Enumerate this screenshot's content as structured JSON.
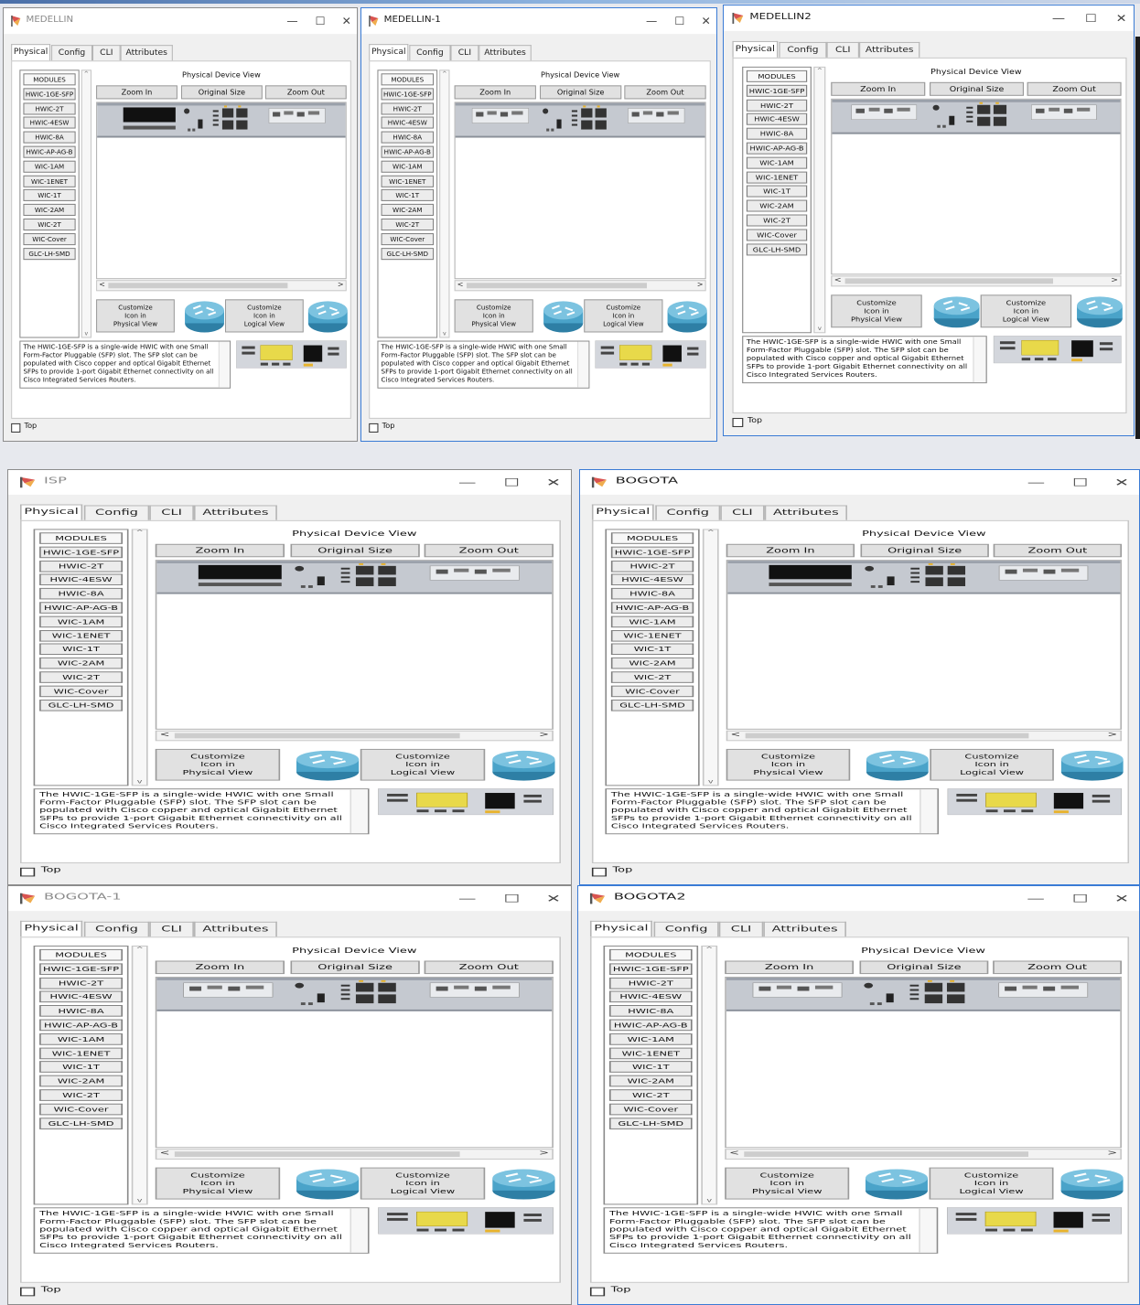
{
  "common": {
    "tabs": [
      "Physical",
      "Config",
      "CLI",
      "Attributes"
    ],
    "physical_device_view_label": "Physical Device View",
    "zoom_in": "Zoom In",
    "original_size": "Original Size",
    "zoom_out": "Zoom Out",
    "module_header": "MODULES",
    "module_list": [
      "HWIC-1GE-SFP",
      "HWIC-2T",
      "HWIC-4ESW",
      "HWIC-8A",
      "HWIC-AP-AG-B",
      "WIC-1AM",
      "WIC-1ENET",
      "WIC-1T",
      "WIC-2AM",
      "WIC-2T",
      "WIC-Cover",
      "GLC-LH-SMD"
    ],
    "customize_physical": "Customize\nIcon in\nPhysical View",
    "customize_logical": "Customize\nIcon in\nLogical View",
    "description": "The HWIC-1GE-SFP is a single-wide HWIC with one Small Form-Factor Pluggable (SFP) slot. The SFP slot can be populated with Cisco copper and optical Gigabit Ethernet SFPs to provide 1-port Gigabit Ethernet connectivity on all Cisco Integrated Services Routers.",
    "top_label": "Top",
    "minimize_glyph": "—",
    "maximize_glyph": "☐",
    "close_glyph": "✕",
    "scroll_left": "<",
    "scroll_right": ">",
    "scroll_up": "^",
    "scroll_down": "v"
  },
  "windows": [
    {
      "title": "MEDELLIN",
      "state": "inactive"
    },
    {
      "title": "MEDELLIN-1",
      "state": "active"
    },
    {
      "title": "MEDELLIN2",
      "state": "active"
    },
    {
      "title": "ISP",
      "state": "inactive"
    },
    {
      "title": "BOGOTA",
      "state": "active"
    },
    {
      "title": "BOGOTA-1",
      "state": "inactive"
    },
    {
      "title": "BOGOTA2",
      "state": "active"
    }
  ],
  "colors": {
    "chassis": "#c5c9d0",
    "router_blue": "#4aa3c9",
    "active_border": "#3a7bd5",
    "module_yellow": "#e8d94a"
  }
}
